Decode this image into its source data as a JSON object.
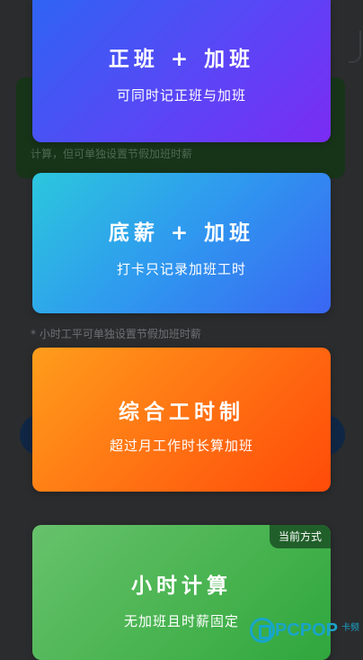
{
  "background": {
    "note_1": "计算，但可单独设置节假加班时薪",
    "note_2": "* 小时工平可单独设置节假加班时薪"
  },
  "options": [
    {
      "title": "正班 + 加班",
      "subtitle": "可同时记正班与加班"
    },
    {
      "title": "底薪 + 加班",
      "subtitle": "打卡只记录加班工时"
    },
    {
      "title": "综合工时制",
      "subtitle": "超过月工作时长算加班"
    },
    {
      "title": "小时计算",
      "subtitle": "无加班且时薪固定",
      "badge": "当前方式"
    }
  ],
  "watermark": {
    "text": "PCPOP",
    "tag": "卡频"
  },
  "colors": {
    "card_1": "#5a46f6",
    "card_2": "#2f98ef",
    "card_3": "#ff6f12",
    "card_4": "#46b24e",
    "badge": "#215f2a",
    "watermark": "#1aa4c8"
  }
}
